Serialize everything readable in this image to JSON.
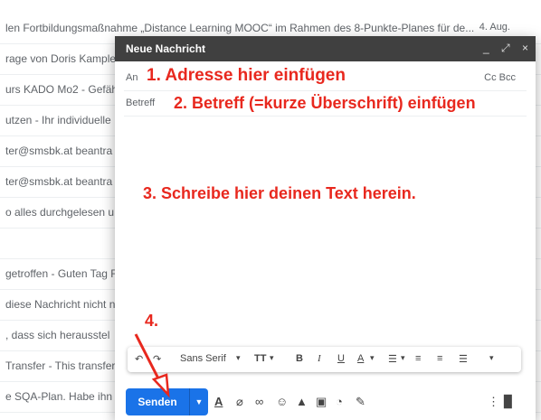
{
  "inbox": {
    "rows": [
      {
        "text": "len Fortbildungsmaßnahme „Distance Learning MOOC“ im Rahmen des 8-Punkte-Planes für de...",
        "date": "4. Aug."
      },
      {
        "text": "rage von Doris Kample",
        "date": ""
      },
      {
        "text": "urs KADO Mo2 - Gefäh",
        "date": ""
      },
      {
        "text": "utzen - Ihr individuelle",
        "date": ""
      },
      {
        "text": "ter@smsbk.at beantra",
        "date": ""
      },
      {
        "text": "ter@smsbk.at beantra",
        "date": ""
      },
      {
        "text": "o alles durchgelesen u",
        "date": ""
      },
      {
        "text": "",
        "date": ""
      },
      {
        "text": "getroffen - Guten Tag F",
        "date": ""
      },
      {
        "text": "diese Nachricht nicht n",
        "date": ""
      },
      {
        "text": ", dass sich herausstel",
        "date": ""
      },
      {
        "text": "Transfer - This transfer",
        "date": ""
      },
      {
        "text": "e SQA-Plan. Habe ihn",
        "date": ""
      }
    ]
  },
  "compose": {
    "title": "Neue Nachricht",
    "header_icons": {
      "minimize": "_",
      "expand": "⤢",
      "close": "×"
    },
    "to_label": "An",
    "ccbcc": "Cc Bcc",
    "subject_label": "Betreff",
    "font_name": "Sans Serif",
    "send_label": "Senden"
  },
  "annotations": {
    "step1": "1. Adresse hier einfügen",
    "step2": "2. Betreff (=kurze Überschrift) einfügen",
    "step3": "3. Schreibe hier deinen Text herein.",
    "step4": "4."
  },
  "colors": {
    "accent": "#1a73e8",
    "header": "#404040",
    "annotation": "#e8281e"
  }
}
